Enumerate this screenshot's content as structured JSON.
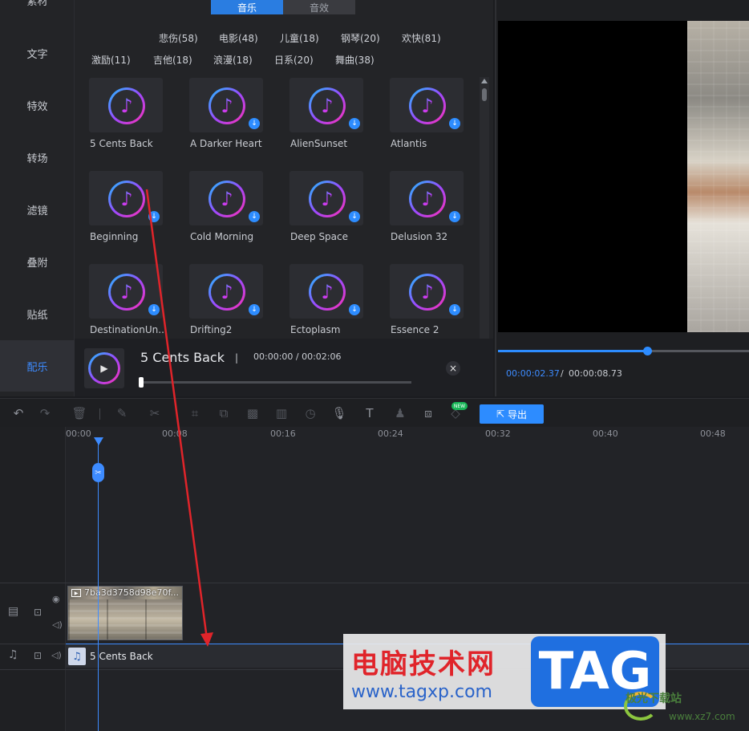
{
  "sidenav": {
    "items": [
      {
        "label": "素材",
        "active": false
      },
      {
        "label": "文字",
        "active": false
      },
      {
        "label": "特效",
        "active": false
      },
      {
        "label": "转场",
        "active": false
      },
      {
        "label": "滤镜",
        "active": false
      },
      {
        "label": "叠附",
        "active": false
      },
      {
        "label": "贴纸",
        "active": false
      },
      {
        "label": "配乐",
        "active": true
      }
    ]
  },
  "library": {
    "tabs": {
      "music": "音乐",
      "sfx": "音效"
    },
    "genres_row1": [
      "悲伤(58)",
      "电影(48)",
      "儿童(18)",
      "钢琴(20)",
      "欢快(81)"
    ],
    "genres_row2": [
      "激励(11)",
      "吉他(18)",
      "浪漫(18)",
      "日系(20)",
      "舞曲(38)"
    ],
    "tracks": [
      {
        "title": "5 Cents Back",
        "downloadable": false
      },
      {
        "title": "A Darker Heart",
        "downloadable": true
      },
      {
        "title": "AlienSunset",
        "downloadable": true
      },
      {
        "title": "Atlantis",
        "downloadable": true
      },
      {
        "title": "Beginning",
        "downloadable": true
      },
      {
        "title": "Cold Morning",
        "downloadable": true
      },
      {
        "title": "Deep Space",
        "downloadable": true
      },
      {
        "title": "Delusion 32",
        "downloadable": true
      },
      {
        "title": "DestinationUn...",
        "downloadable": true
      },
      {
        "title": "Drifting2",
        "downloadable": true
      },
      {
        "title": "Ectoplasm",
        "downloadable": true
      },
      {
        "title": "Essence 2",
        "downloadable": true
      }
    ]
  },
  "player": {
    "title": "5 Cents Back",
    "separator": "|",
    "time": "00:00:00 / 00:02:06",
    "close": "×",
    "progress": 0
  },
  "preview": {
    "current": "00:00:02.37",
    "slash": "/",
    "duration": "00:00:08.73",
    "progress": 0.58
  },
  "toolbar": {
    "export_label": "导出",
    "new_badge": "NEW"
  },
  "timeline": {
    "ruler": [
      "00:00",
      "00:08",
      "00:16",
      "00:24",
      "00:32",
      "00:40",
      "00:48"
    ],
    "video_clip_name": "7ba3d3758d98e70f...",
    "audio_clip_name": "5 Cents Back"
  },
  "watermark": {
    "cn": "电脑技术网",
    "url": "www.tagxp.com",
    "tag": "TAG",
    "site": "极光下载站",
    "site_url": "www.xz7.com"
  },
  "colors": {
    "accent": "#2d8cff",
    "annotation_arrow": "#e0242a"
  }
}
